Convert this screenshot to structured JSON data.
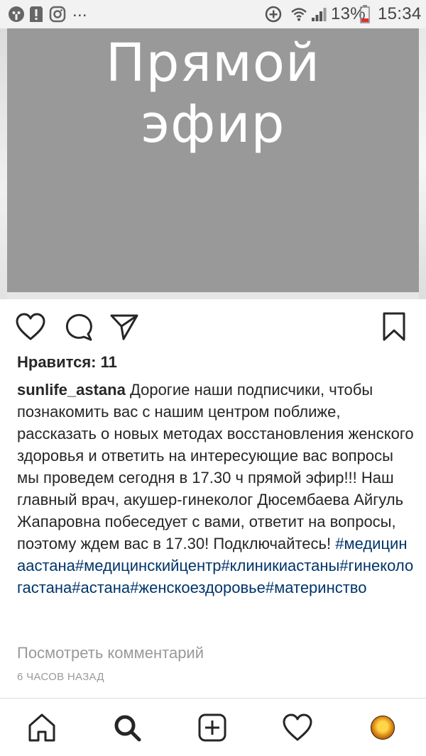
{
  "status_bar": {
    "battery": "13%",
    "time": "15:34",
    "icons": [
      "face-app-icon",
      "alert-icon",
      "instagram-icon",
      "more-dots-icon",
      "data-saver-icon",
      "wifi-icon",
      "signal-icon",
      "battery-icon"
    ],
    "more_dots": "..."
  },
  "post": {
    "image_title_line1": "Прямой",
    "image_title_line2": "эфир",
    "actions": [
      "heart-icon",
      "comment-icon",
      "share-icon",
      "bookmark-icon"
    ],
    "likes": "Нравится: 11",
    "username": "sunlife_astana",
    "caption": " Дорогие наши подписчики, чтобы познакомить вас с нашим центром поближе, рассказать о новых методах восстановления женского здоровья и ответить на интересующие вас вопросы мы проведем сегодня в 17.30 ч прямой эфир!!! Наш главный врач, акушер-гинеколог Дюсембаева Айгуль Жапаровна побеседует с вами, ответит на вопросы, поэтому ждем вас в 17.30! Подключайтесь!",
    "hashtags": "#медицинаастана#медицинскийцентр#клиникиастаны#гинекологастана#астана#женскоездоровье#материнство",
    "view_comments": "Посмотреть комментарий",
    "time_ago": "6 ЧАСОВ НАЗАД"
  },
  "bottom_nav": {
    "items": [
      "home-icon",
      "search-icon",
      "new-post-icon",
      "activity-heart-icon",
      "profile-avatar"
    ]
  },
  "colors": {
    "image_gray": "#999999",
    "hashtag": "#003569",
    "muted": "#999999",
    "text": "#262626"
  }
}
